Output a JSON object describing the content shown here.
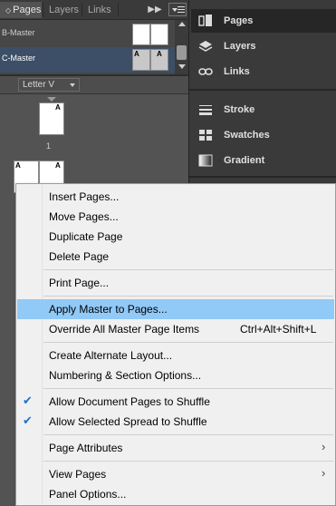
{
  "pages_panel": {
    "tabs": [
      {
        "label": "Pages",
        "active": true
      },
      {
        "label": "Layers",
        "active": false
      },
      {
        "label": "Links",
        "active": false
      }
    ],
    "collapse_icon": "double-chevron-right-icon",
    "panel_menu_icon": "panel-menu-icon",
    "masters": [
      {
        "label": "B-Master",
        "selected": false
      },
      {
        "label": "C-Master",
        "selected": true
      }
    ],
    "master_page_letter": "A",
    "page_size": "Letter V",
    "page_letter": "A",
    "page_number": "1",
    "spread_letters": [
      "A",
      "A"
    ]
  },
  "dock": {
    "items": [
      {
        "label": "Pages",
        "icon": "pages-icon",
        "active": true
      },
      {
        "label": "Layers",
        "icon": "layers-icon",
        "active": false
      },
      {
        "label": "Links",
        "icon": "links-icon",
        "active": false
      },
      {
        "label": "Stroke",
        "icon": "stroke-icon",
        "active": false
      },
      {
        "label": "Swatches",
        "icon": "swatches-icon",
        "active": false
      },
      {
        "label": "Gradient",
        "icon": "gradient-icon",
        "active": false
      }
    ]
  },
  "context_menu": {
    "items": [
      {
        "label": "Insert Pages..."
      },
      {
        "label": "Move Pages..."
      },
      {
        "label": "Duplicate Page"
      },
      {
        "label": "Delete Page"
      },
      {
        "label": "Print Page..."
      },
      {
        "label": "Apply Master to Pages...",
        "highlighted": true
      },
      {
        "label": "Override All Master Page Items",
        "shortcut": "Ctrl+Alt+Shift+L"
      },
      {
        "label": "Create Alternate Layout..."
      },
      {
        "label": "Numbering & Section Options..."
      },
      {
        "label": "Allow Document Pages to Shuffle",
        "checked": true
      },
      {
        "label": "Allow Selected Spread to Shuffle",
        "checked": true
      },
      {
        "label": "Page Attributes",
        "submenu": true
      },
      {
        "label": "View Pages",
        "submenu": true
      },
      {
        "label": "Panel Options..."
      }
    ],
    "check_glyph": "✔",
    "submenu_glyph": "›"
  },
  "colors": {
    "panel_bg": "#535353",
    "dock_bg": "#3a3a3a",
    "menu_bg": "#f0f0f0",
    "highlight": "#91c9f7",
    "check": "#1e6fd0"
  }
}
